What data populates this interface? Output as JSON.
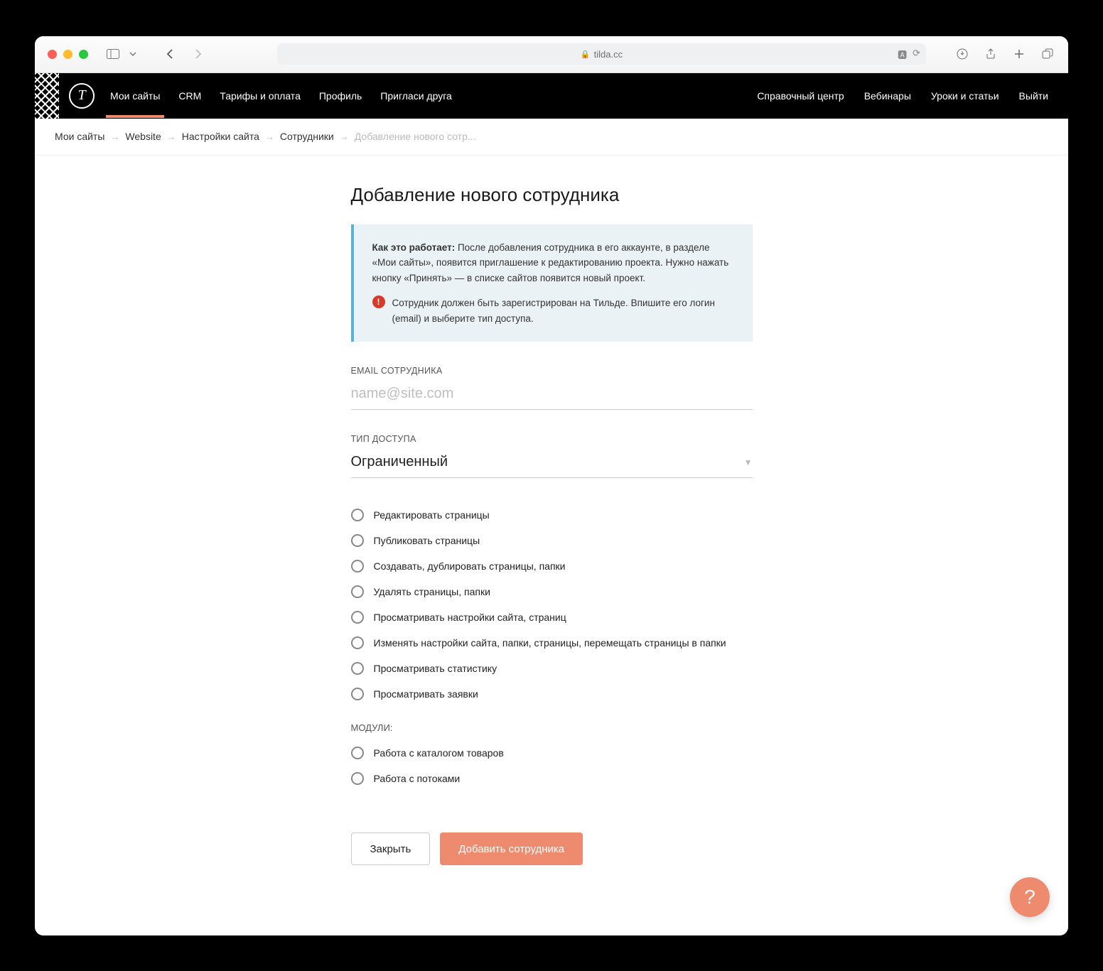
{
  "browser": {
    "url_host": "tilda.cc"
  },
  "topnav": {
    "logo_letter": "T",
    "left": [
      "Мои сайты",
      "CRM",
      "Тарифы и оплата",
      "Профиль",
      "Пригласи друга"
    ],
    "right": [
      "Справочный центр",
      "Вебинары",
      "Уроки и статьи",
      "Выйти"
    ]
  },
  "breadcrumb": {
    "items": [
      "Мои сайты",
      "Website",
      "Настройки сайта",
      "Сотрудники",
      "Добавление нового сотр..."
    ]
  },
  "page": {
    "title": "Добавление нового сотрудника",
    "info_bold": "Как это работает:",
    "info_text": " После добавления сотрудника в его аккаунте, в разделе «Мои сайты», появится приглашение к редактированию проекта. Нужно нажать кнопку «Принять» — в списке сайтов появится новый проект.",
    "warn_text": "Сотрудник должен быть зарегистрирован на Тильде. Впишите его логин (email) и выберите тип доступа."
  },
  "form": {
    "email_label": "EMAIL СОТРУДНИКА",
    "email_placeholder": "name@site.com",
    "access_label": "ТИП ДОСТУПА",
    "access_value": "Ограниченный",
    "permissions": [
      "Редактировать страницы",
      "Публиковать страницы",
      "Создавать, дублировать страницы, папки",
      "Удалять страницы, папки",
      "Просматривать настройки сайта, страниц",
      "Изменять настройки сайта, папки, страницы, перемещать страницы в папки",
      "Просматривать статистику",
      "Просматривать заявки"
    ],
    "modules_label": "МОДУЛИ:",
    "modules": [
      "Работа с каталогом товаров",
      "Работа с потоками"
    ],
    "close_btn": "Закрыть",
    "submit_btn": "Добавить сотрудника"
  },
  "help_fab": "?"
}
